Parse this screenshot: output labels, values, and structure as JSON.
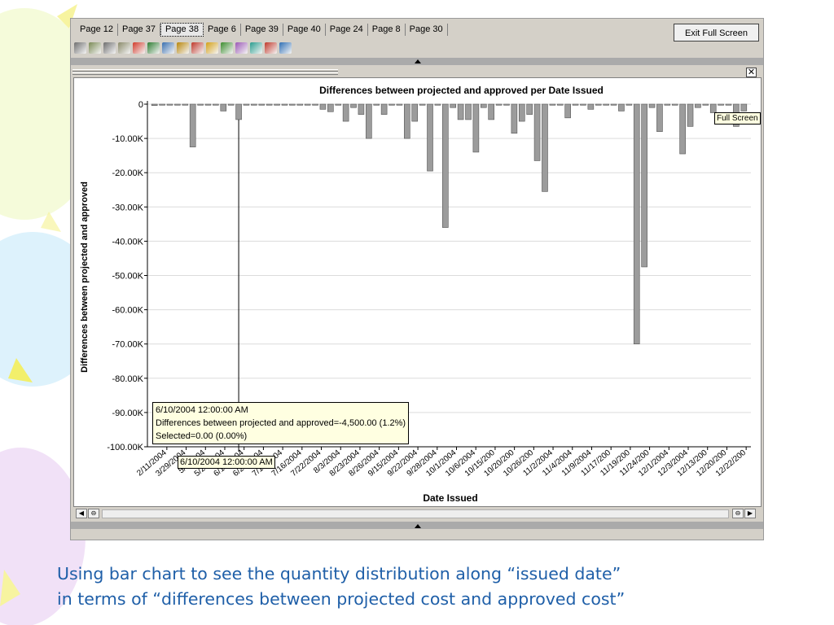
{
  "tabs": [
    "Page 12",
    "Page 37",
    "Page 38",
    "Page 6",
    "Page 39",
    "Page 40",
    "Page 24",
    "Page 8",
    "Page 30"
  ],
  "active_tab": "Page 38",
  "exit_button": "Exit Full Screen",
  "toolbar_icons": [
    "table-view-icon",
    "list-view-icon",
    "grid-view-icon",
    "report-view-icon",
    "pie-chart-icon",
    "bar-chart-icon",
    "line-chart-icon",
    "area-chart-icon",
    "scatter-chart-icon",
    "stacked-bar-icon",
    "column-chart-icon",
    "bubble-chart-icon",
    "histogram-icon",
    "3d-bar-icon",
    "globe-icon"
  ],
  "close_label": "✕",
  "fullscreen_tooltip": "Full Screen",
  "hover_tooltip": {
    "line1": "6/10/2004 12:00:00 AM",
    "line2": "Differences between projected and approved=-4,500.00 (1.2%)",
    "line3": "Selected=0.00 (0.00%)"
  },
  "axis_tooltip": "6/10/2004 12:00:00 AM",
  "chart_data": {
    "type": "bar",
    "title": "Differences between projected and approved per  Date  Issued",
    "xlabel": "Date  Issued",
    "ylabel": "Differences between projected and approved",
    "ylim": [
      -100000,
      0
    ],
    "yticks": [
      "0",
      "-10.00K",
      "-20.00K",
      "-30.00K",
      "-40.00K",
      "-50.00K",
      "-60.00K",
      "-70.00K",
      "-80.00K",
      "-90.00K",
      "-100.00K"
    ],
    "xtick_labels": [
      "2/11/2004",
      "3/29/2004",
      "5/7/2004",
      "5/26/2004",
      "6/10/2004",
      "6/21/2004",
      "7/12/2004",
      "7/16/2004",
      "7/22/2004",
      "8/3/2004",
      "8/23/2004",
      "8/26/2004",
      "9/15/2004",
      "9/22/2004",
      "9/28/2004",
      "10/1/2004",
      "10/6/2004",
      "10/15/200",
      "10/20/200",
      "10/26/200",
      "11/2/2004",
      "11/4/2004",
      "11/9/2004",
      "11/17/200",
      "11/19/200",
      "11/24/200",
      "12/1/2004",
      "12/3/2004",
      "12/13/200",
      "12/20/200",
      "12/22/200"
    ],
    "values": [
      -400,
      -300,
      -300,
      -300,
      -300,
      -12500,
      -300,
      -300,
      -300,
      -2000,
      -300,
      -4500,
      -300,
      -300,
      -300,
      -300,
      -300,
      -300,
      -300,
      -300,
      -300,
      -300,
      -1500,
      -2200,
      -300,
      -5000,
      -1000,
      -3000,
      -10000,
      -300,
      -3000,
      -300,
      -300,
      -10000,
      -5000,
      -300,
      -19500,
      -300,
      -36000,
      -1000,
      -4500,
      -4500,
      -14000,
      -1000,
      -4500,
      -300,
      -300,
      -8500,
      -5000,
      -3000,
      -16500,
      -25500,
      -300,
      -300,
      -4000,
      -300,
      -300,
      -1500,
      -300,
      -300,
      -300,
      -2000,
      -300,
      -70000,
      -47500,
      -1000,
      -8000,
      -300,
      -300,
      -14500,
      -6500,
      -1000,
      -300,
      -2500,
      -300,
      -300,
      -6500,
      -2000
    ],
    "grid": true,
    "bar_color": "#9c9c9c"
  },
  "caption": {
    "line1": "Using bar chart to see the quantity distribution along “issued date”",
    "line2": "in terms of “differences between projected cost and approved cost”"
  }
}
